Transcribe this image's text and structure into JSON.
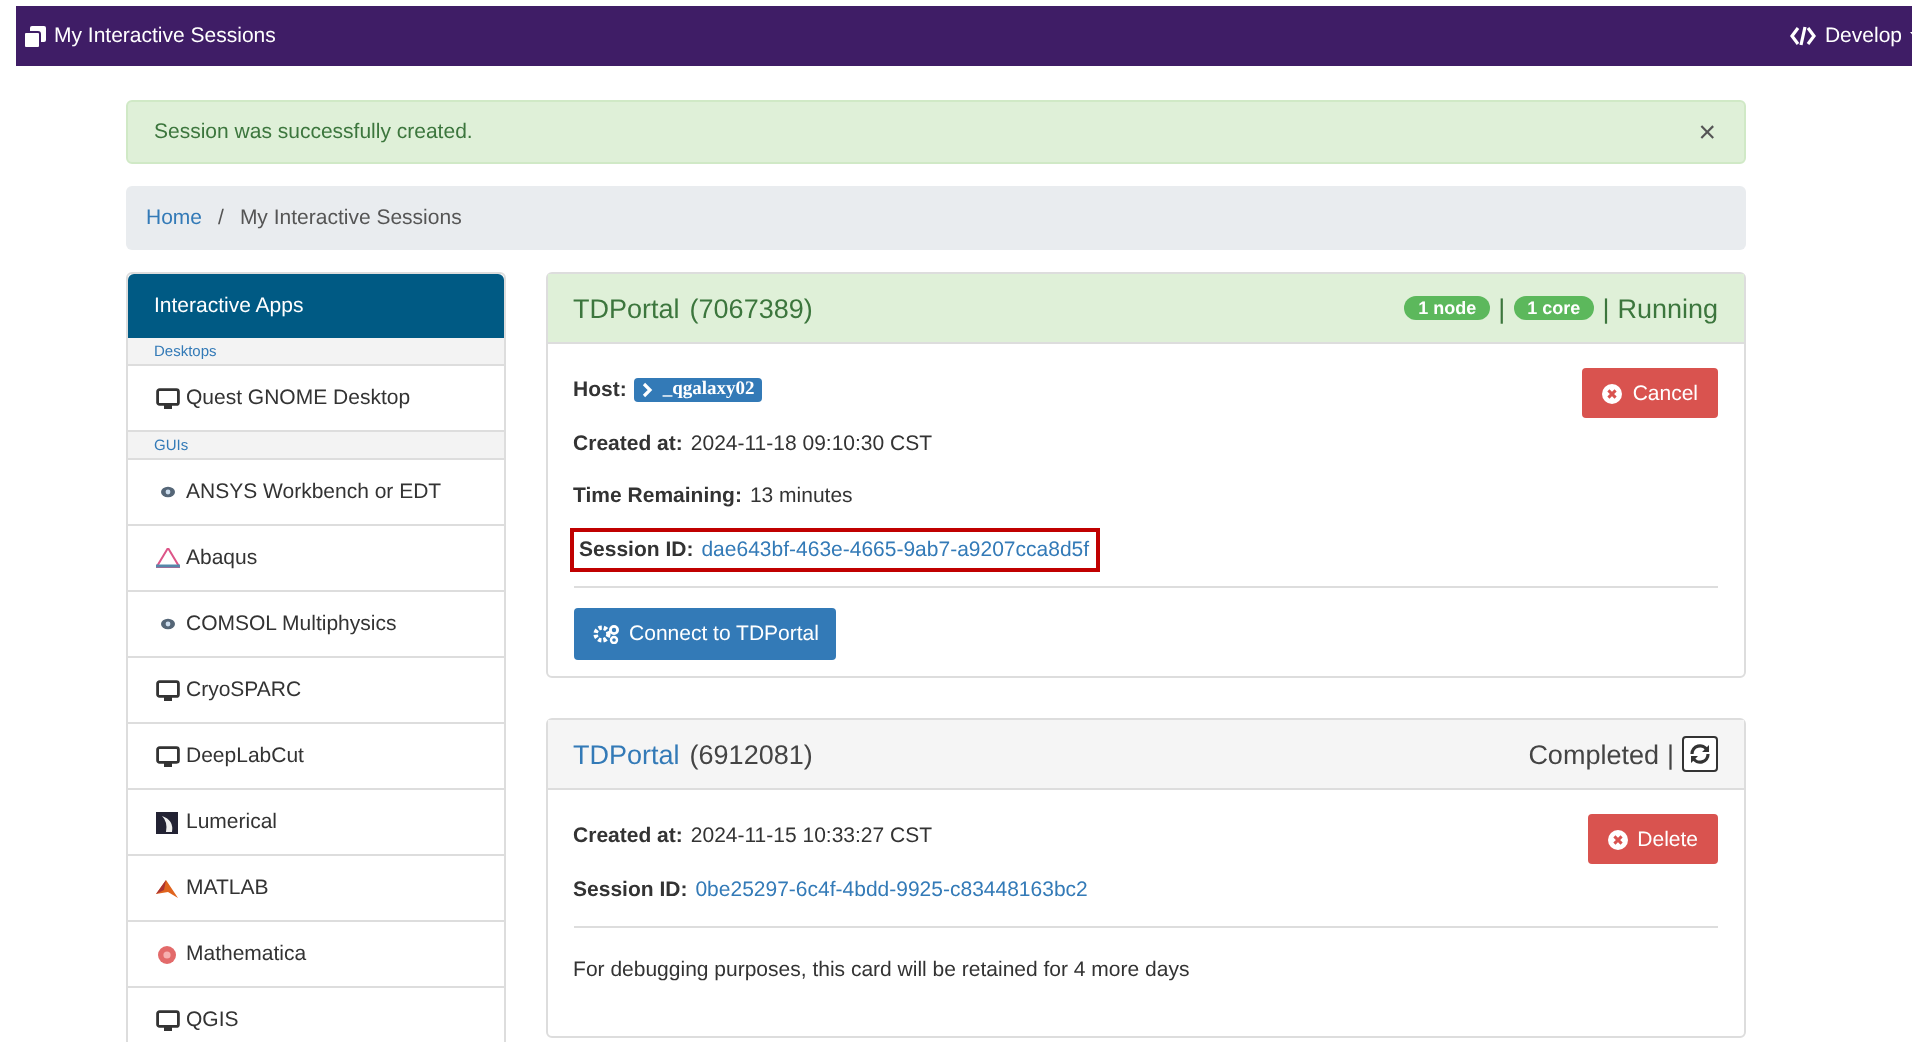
{
  "navbar": {
    "title": "My Interactive Sessions",
    "menu": "Develop"
  },
  "alert": {
    "message": "Session was successfully created.",
    "dismiss": "×"
  },
  "breadcrumb": {
    "separator": "/",
    "items": [
      {
        "label": "Home",
        "link": true
      },
      {
        "label": "My Interactive Sessions",
        "link": false
      }
    ]
  },
  "sidebar": {
    "title": "Interactive Apps",
    "groups": [
      {
        "label": "Desktops",
        "items": [
          {
            "label": "Quest GNOME Desktop",
            "kind": "desktop"
          }
        ]
      },
      {
        "label": "GUIs",
        "items": [
          {
            "label": "ANSYS Workbench or EDT",
            "kind": "dot"
          },
          {
            "label": "Abaqus",
            "kind": "triangle"
          },
          {
            "label": "COMSOL Multiphysics",
            "kind": "dot"
          },
          {
            "label": "CryoSPARC",
            "kind": "desktop"
          },
          {
            "label": "DeepLabCut",
            "kind": "desktop"
          },
          {
            "label": "Lumerical",
            "kind": "square"
          },
          {
            "label": "MATLAB",
            "kind": "peak"
          },
          {
            "label": "Mathematica",
            "kind": "flower"
          },
          {
            "label": "QGIS",
            "kind": "desktop"
          }
        ]
      }
    ]
  },
  "sessions": [
    {
      "app": "TDPortal",
      "app_link": false,
      "job_id": "(7067389)",
      "kind": "running",
      "badges": [
        "1 node",
        "1 core"
      ],
      "separator": "|",
      "status": "Running",
      "fields": [
        {
          "label": "Host:",
          "value": "_qgalaxy02",
          "kind": "host"
        },
        {
          "label": "Created at:",
          "value": "2024-11-18 09:10:30 CST",
          "kind": "text"
        },
        {
          "label": "Time Remaining:",
          "value": "13 minutes",
          "kind": "text"
        },
        {
          "label": "Session ID:",
          "value": "dae643bf-463e-4665-9ab7-a9207cca8d5f",
          "kind": "link",
          "highlighted": true
        }
      ],
      "action": "Cancel",
      "connect": "Connect to TDPortal"
    },
    {
      "app": "TDPortal",
      "app_link": true,
      "job_id": "(6912081)",
      "kind": "completed",
      "separator": "|",
      "status": "Completed",
      "refresh": true,
      "fields": [
        {
          "label": "Created at:",
          "value": "2024-11-15 10:33:27 CST",
          "kind": "text"
        },
        {
          "label": "Session ID:",
          "value": "0be25297-6c4f-4bdd-9925-c83448163bc2",
          "kind": "link"
        }
      ],
      "action": "Delete",
      "note": "For debugging purposes, this card will be retained for 4 more days"
    }
  ]
}
